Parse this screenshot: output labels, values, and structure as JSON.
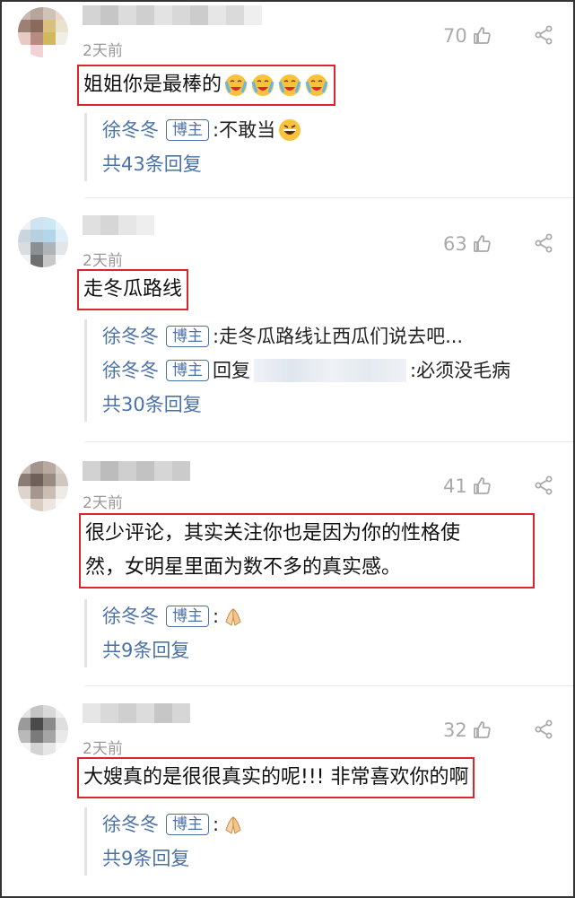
{
  "colors": {
    "highlight_border": "#d9262b",
    "author_blue": "#4b72a6",
    "meta_gray": "#999999"
  },
  "icons": {
    "like": "thumbs-up-icon",
    "share": "share-icon"
  },
  "comments": [
    {
      "time": "2天前",
      "likes": "70",
      "text": "姐姐你是最棒的",
      "replies": [
        {
          "author": "徐冬冬",
          "badge": "博主",
          "sep": ":",
          "text": " 不敢当"
        }
      ],
      "more": "共43条回复"
    },
    {
      "time": "2天前",
      "likes": "63",
      "text": "走冬瓜路线",
      "replies": [
        {
          "author": "徐冬冬",
          "badge": "博主",
          "sep": ":",
          "text": " 走冬瓜路线让西瓜们说去吧..."
        },
        {
          "author": "徐冬冬",
          "badge": "博主",
          "prefix": "回复",
          "text": ":必须没毛病"
        }
      ],
      "more": "共30条回复"
    },
    {
      "time": "2天前",
      "likes": "41",
      "text_line1": "很少评论，其实关注你也是因为你的性格使",
      "text_line2": "然，女明星里面为数不多的真实感。",
      "replies": [
        {
          "author": "徐冬冬",
          "badge": "博主",
          "sep": ":"
        }
      ],
      "more": "共9条回复"
    },
    {
      "time": "2天前",
      "likes": "32",
      "text": "大嫂真的是很很真实的呢!!! 非常喜欢你的啊",
      "replies": [
        {
          "author": "徐冬冬",
          "badge": "博主",
          "sep": ":"
        }
      ],
      "more": "共9条回复"
    }
  ]
}
